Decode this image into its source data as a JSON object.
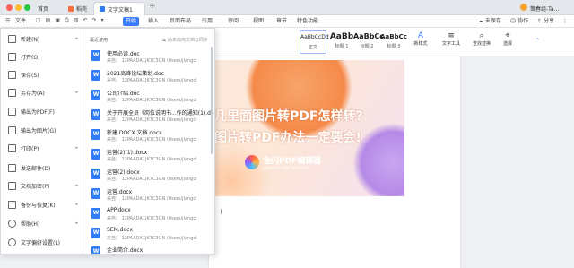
{
  "window": {
    "tabs": [
      {
        "label": "首页"
      },
      {
        "label": "稻壳"
      },
      {
        "label": "文字文稿1"
      }
    ],
    "user_label": "策春组-Ta..."
  },
  "ribbon": {
    "file_label": "文件",
    "items": [
      "开始",
      "插入",
      "页面布局",
      "引用",
      "审阅",
      "视图",
      "章节",
      "特色功能"
    ],
    "active": "开始",
    "right": {
      "unsaved": "未保存",
      "collab": "协作",
      "share": "分享"
    }
  },
  "toolbar": {
    "styles": [
      {
        "preview": "AaBbCcDd",
        "name": "正文"
      },
      {
        "preview": "AaBb",
        "name": "标题 1"
      },
      {
        "preview": "AaBbCc",
        "name": "标题 2"
      },
      {
        "preview": "AaBbCc",
        "name": "标题 3"
      }
    ],
    "new_style": "新样式",
    "text_tools": "文字工具",
    "find_replace": "查找替换",
    "select": "选择"
  },
  "file_menu": {
    "items": [
      {
        "label": "新建(N)",
        "arrow": true
      },
      {
        "label": "打开(O)",
        "arrow": false
      },
      {
        "label": "保存(S)",
        "arrow": false
      },
      {
        "label": "另存为(A)",
        "arrow": true
      },
      {
        "label": "输出为PDF(F)",
        "arrow": false
      },
      {
        "label": "输出为图片(G)",
        "arrow": false
      },
      {
        "label": "打印(P)",
        "arrow": true
      },
      {
        "label": "发送邮件(D)",
        "arrow": false
      },
      {
        "label": "文档加密(P)",
        "arrow": true
      },
      {
        "label": "备份与恢复(K)",
        "arrow": true
      },
      {
        "label": "帮助(H)",
        "arrow": true
      },
      {
        "label": "文字偏好设置(L)",
        "arrow": false
      }
    ],
    "recent_header": "最近使用",
    "sync_label": "尚未启用文档云同步",
    "recent_docs": [
      {
        "name": "使用必读.doc",
        "path": "来自： 12PAADA1JK7C3GN /Users/jiangcl"
      },
      {
        "name": "2021高峰论坛策划.doc",
        "path": "来自： 12PAADA1JK7C3GN /Users/jiangcl"
      },
      {
        "name": "公司介绍.doc",
        "path": "来自： 12PAADA1JK7C3GN /Users/jiangcl"
      },
      {
        "name": "关于开展全员《岗位说明书...作的通知(1).do",
        "path": "来自： 12PAADA1JK7C3GN /Users/jiangcl"
      },
      {
        "name": "新建 DOCX 文档.docx",
        "path": "来自： 12PAADA1JK7C3GN /Users/jiangcl"
      },
      {
        "name": "运营(2)(1).docx",
        "path": "来自： 12PAADA1JK7C3GN /Users/jiangcl"
      },
      {
        "name": "运营(2).docx",
        "path": "来自： 12PAADA1JK7C3GN /Users/jiangcl"
      },
      {
        "name": "运营.docx",
        "path": "来自： 12PAADA1JK7C3GN /Users/jiangcl"
      },
      {
        "name": "APP.docx",
        "path": "来自： 12PAADA1JK7C3GN /Users/jiangcl"
      },
      {
        "name": "SEM.docx",
        "path": "来自： 12PAADA1JK7C3GN /Users/jiangcl"
      },
      {
        "name": "企业简介.docx",
        "path": ""
      }
    ]
  },
  "banner": {
    "line1": "几里面图片转PDF怎样转?",
    "line2": "图片转PDF办法一定要会!",
    "brand_name": "金闪PDF编辑器",
    "brand_sub": "JINSHAN PDF EDITOR"
  }
}
